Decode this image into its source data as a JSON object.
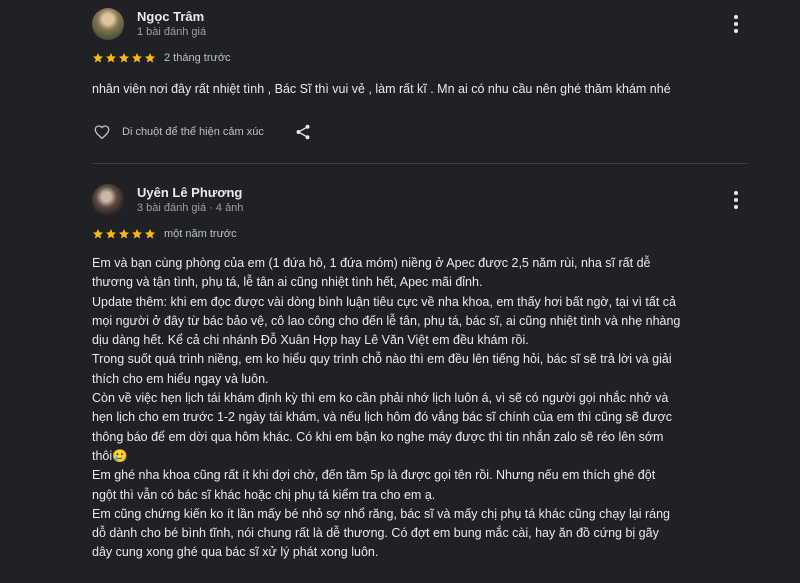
{
  "reviews": [
    {
      "author": "Ngọc Trâm",
      "meta": "1 bài đánh giá",
      "rating": 5,
      "time": "2 tháng trước",
      "lines": [
        "nhân viên nơi đây rất nhiệt tình , Bác Sĩ thì vui vẻ , làm rất kĩ . Mn ai có nhu cầu nên ghé thăm khám nhé"
      ],
      "like_hint": "Di chuột để thể hiện cảm xúc",
      "icons": [
        "heart-icon",
        "share-icon",
        "more-vert-icon"
      ]
    },
    {
      "author": "Uyên Lê Phương",
      "meta": "3 bài đánh giá · 4 ảnh",
      "rating": 5,
      "time": "một năm trước",
      "lines": [
        "Em và bạn cùng phòng của em (1 đứa hô, 1 đứa móm) niềng ở Apec được 2,5 năm rùi, nha sĩ rất dễ",
        "thương và tận tình, phụ tá, lễ tân ai cũng nhiệt tình hết, Apec mãi đỉnh.",
        "Update thêm: khi em đọc được vài dòng bình luận tiêu cực về nha khoa, em thấy hơi bất ngờ, tại vì tất cả",
        "mọi người ở đây từ bác bảo vệ, cô lao công cho đến lễ tân, phụ tá, bác sĩ, ai cũng nhiệt tình và nhẹ nhàng",
        "dịu dàng hết. Kể cả chi nhánh Đỗ Xuân Hợp hay Lê Văn Việt em đều khám rồi.",
        "Trong suốt quá trình niềng, em ko hiểu quy trình chỗ nào thì em đều lên tiếng hỏi, bác sĩ sẽ trả lời và giải",
        "thích cho em hiểu ngay và luôn.",
        "Còn về việc hẹn lịch tái khám định kỳ thì em ko cần phải nhớ lịch luôn á, vì sẽ có người gọi nhắc nhở và",
        "hẹn lịch cho em trước 1-2 ngày tái khám, và nếu lịch hôm đó vắng bác sĩ chính của em thì cũng sẽ được",
        "thông báo để em dời qua hôm khác. Có khi em bận ko nghe máy được thì tin nhắn zalo sẽ réo lên sớm",
        "thôi🥲",
        "Em ghé nha khoa cũng rất ít khi đợi chờ, đến tầm 5p là được gọi tên rồi. Nhưng nếu em thích ghé đột",
        "ngột thì vẫn có bác sĩ khác hoặc chị phụ tá kiểm tra cho em ạ.",
        "Em cũng chứng kiến ko ít lần mấy bé nhỏ sợ nhổ răng, bác sĩ và mấy chị phụ tá khác cũng chạy lại ráng",
        "dỗ dành cho bé bình tĩnh, nói chung rất là dễ thương. Có đợt em bung mắc cài, hay ăn đồ cứng bị gãy",
        "dây cung xong ghé qua bác sĩ xử lý phát xong luôn."
      ],
      "icons": [
        "more-vert-icon"
      ]
    }
  ],
  "colors": {
    "background": "#202124",
    "star": "#fbbc04",
    "text": "#e8eaed",
    "secondary_text": "#9aa0a6",
    "divider": "#3c4043"
  }
}
